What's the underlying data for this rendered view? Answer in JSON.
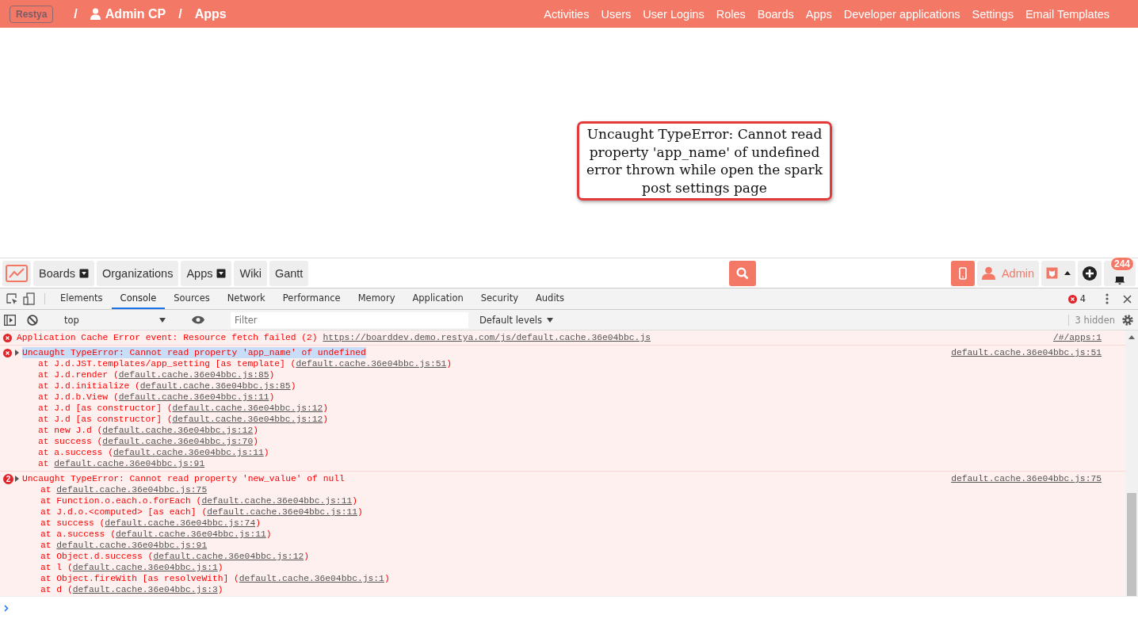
{
  "topbar": {
    "logo": "Restya",
    "separator": "/",
    "breadcrumbs": [
      {
        "label": "Admin CP",
        "kind": "user"
      },
      {
        "label": "Apps",
        "kind": "plain"
      }
    ],
    "nav": [
      "Activities",
      "Users",
      "User Logins",
      "Roles",
      "Boards",
      "Apps",
      "Developer applications",
      "Settings",
      "Email Templates"
    ]
  },
  "callout": {
    "text": "Uncaught TypeError: Cannot read property 'app_name' of undefined error thrown while open the spark post settings page"
  },
  "appbar": {
    "menus": [
      {
        "label": "Boards",
        "dropdown": true
      },
      {
        "label": "Organizations",
        "dropdown": false
      },
      {
        "label": "Apps",
        "dropdown": true
      },
      {
        "label": "Wiki",
        "dropdown": false
      },
      {
        "label": "Gantt",
        "dropdown": false
      }
    ],
    "user": "Admin",
    "notifications": "244"
  },
  "devtools": {
    "tabs": [
      {
        "label": "Elements",
        "selected": false
      },
      {
        "label": "Console",
        "selected": true
      },
      {
        "label": "Sources",
        "selected": false
      },
      {
        "label": "Network",
        "selected": false
      },
      {
        "label": "Performance",
        "selected": false
      },
      {
        "label": "Memory",
        "selected": false
      },
      {
        "label": "Application",
        "selected": false
      },
      {
        "label": "Security",
        "selected": false
      },
      {
        "label": "Audits",
        "selected": false
      }
    ],
    "error_count": "4",
    "context": "top",
    "filter_placeholder": "Filter",
    "levels": "Default levels",
    "hidden": "3 hidden",
    "messages": [
      {
        "text": "Application Cache Error event: Resource fetch failed (2) ",
        "url": "https://boarddev.demo.restya.com/js/default.cache.36e04bbc.js",
        "source": "/#/apps:1",
        "highlighted": false
      },
      {
        "text": "Uncaught TypeError: Cannot read property 'app_name' of undefined",
        "source": "default.cache.36e04bbc.js:51",
        "highlighted": true,
        "stack": [
          {
            "before": "at J.d.JST.templates/app_setting [as template] (",
            "link": "default.cache.36e04bbc.js:51",
            "after": ")"
          },
          {
            "before": "at J.d.render (",
            "link": "default.cache.36e04bbc.js:85",
            "after": ")"
          },
          {
            "before": "at J.d.initialize (",
            "link": "default.cache.36e04bbc.js:85",
            "after": ")"
          },
          {
            "before": "at J.d.b.View (",
            "link": "default.cache.36e04bbc.js:11",
            "after": ")"
          },
          {
            "before": "at J.d [as constructor] (",
            "link": "default.cache.36e04bbc.js:12",
            "after": ")"
          },
          {
            "before": "at J.d [as constructor] (",
            "link": "default.cache.36e04bbc.js:12",
            "after": ")"
          },
          {
            "before": "at new J.d (",
            "link": "default.cache.36e04bbc.js:12",
            "after": ")"
          },
          {
            "before": "at success (",
            "link": "default.cache.36e04bbc.js:70",
            "after": ")"
          },
          {
            "before": "at a.success (",
            "link": "default.cache.36e04bbc.js:11",
            "after": ")"
          },
          {
            "before": "at ",
            "link": "default.cache.36e04bbc.js:91"
          }
        ]
      },
      {
        "count": "2",
        "text": "Uncaught TypeError: Cannot read property 'new_value' of null",
        "source": "default.cache.36e04bbc.js:75",
        "highlighted": false,
        "stack": [
          {
            "before": "at ",
            "link": "default.cache.36e04bbc.js:75"
          },
          {
            "before": "at Function.o.each.o.forEach (",
            "link": "default.cache.36e04bbc.js:11",
            "after": ")"
          },
          {
            "before": "at J.d.o.<computed> [as each] (",
            "link": "default.cache.36e04bbc.js:11",
            "after": ")"
          },
          {
            "before": "at success (",
            "link": "default.cache.36e04bbc.js:74",
            "after": ")"
          },
          {
            "before": "at a.success (",
            "link": "default.cache.36e04bbc.js:11",
            "after": ")"
          },
          {
            "before": "at ",
            "link": "default.cache.36e04bbc.js:91"
          },
          {
            "before": "at Object.d.success (",
            "link": "default.cache.36e04bbc.js:12",
            "after": ")"
          },
          {
            "before": "at l (",
            "link": "default.cache.36e04bbc.js:1",
            "after": ")"
          },
          {
            "before": "at Object.fireWith [as resolveWith] (",
            "link": "default.cache.36e04bbc.js:1",
            "after": ")"
          },
          {
            "before": "at d (",
            "link": "default.cache.36e04bbc.js:3",
            "after": ")"
          }
        ]
      }
    ]
  }
}
